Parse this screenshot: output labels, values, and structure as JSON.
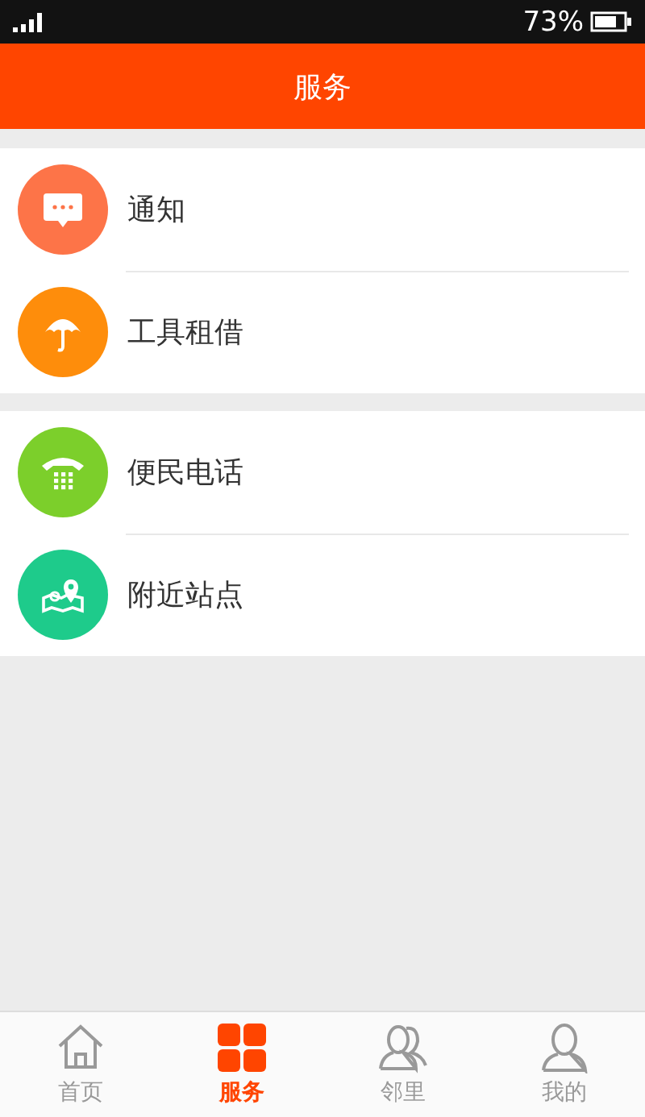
{
  "status_bar": {
    "battery_text": "73%"
  },
  "header": {
    "title": "服务"
  },
  "groups": [
    {
      "items": [
        {
          "label": "通知",
          "kind": "message",
          "color": "#fd7448"
        },
        {
          "label": "工具租借",
          "kind": "umbrella",
          "color": "#fe8d0b"
        }
      ]
    },
    {
      "items": [
        {
          "label": "便民电话",
          "kind": "phone",
          "color": "#7ccf2b"
        },
        {
          "label": "附近站点",
          "kind": "map",
          "color": "#1ecb8b"
        }
      ]
    }
  ],
  "tabs": [
    {
      "label": "首页",
      "kind": "home",
      "selected": false
    },
    {
      "label": "服务",
      "kind": "grid",
      "selected": true
    },
    {
      "label": "邻里",
      "kind": "people",
      "selected": false
    },
    {
      "label": "我的",
      "kind": "person",
      "selected": false
    }
  ]
}
